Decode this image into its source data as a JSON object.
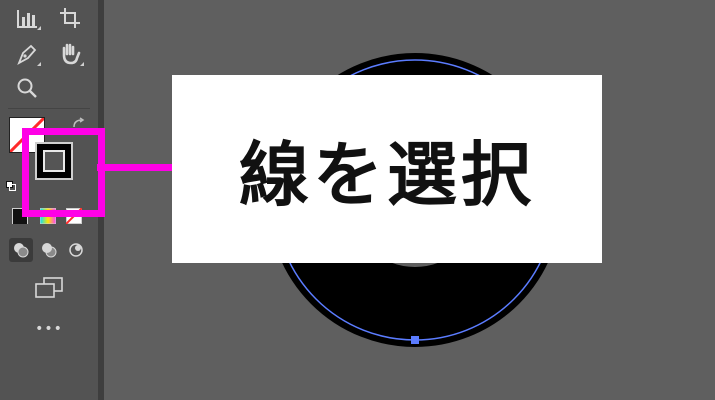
{
  "callout": {
    "text": "線を選択"
  },
  "colors": {
    "highlight": "#ff00e6",
    "canvas": "#5f5f5f",
    "toolbar": "#535353",
    "artwork_stroke": "#000000",
    "path": "#5b7cff"
  },
  "toolbar": {
    "tools": [
      {
        "name": "column-graph-tool",
        "icon": "bar-chart-icon"
      },
      {
        "name": "artboard-tool",
        "icon": "artboard-icon"
      },
      {
        "name": "pen-tool",
        "icon": "pen-icon"
      },
      {
        "name": "hand-tool",
        "icon": "hand-icon"
      },
      {
        "name": "zoom-tool",
        "icon": "magnifier-icon"
      },
      {
        "name": "fill-swatch",
        "icon": "fill-none-icon"
      },
      {
        "name": "stroke-swatch",
        "icon": "stroke-icon"
      },
      {
        "name": "swap-fill-stroke",
        "icon": "swap-arrow-icon"
      },
      {
        "name": "color-mode",
        "icon": "color-icon"
      },
      {
        "name": "gradient-mode",
        "icon": "gradient-icon"
      },
      {
        "name": "none-mode",
        "icon": "none-icon"
      },
      {
        "name": "draw-normal",
        "icon": "draw-normal-icon"
      },
      {
        "name": "draw-behind",
        "icon": "draw-behind-icon"
      },
      {
        "name": "draw-inside",
        "icon": "draw-inside-icon"
      },
      {
        "name": "change-screen-mode",
        "icon": "screen-mode-icon"
      },
      {
        "name": "edit-toolbar",
        "icon": "more-icon"
      }
    ],
    "more_label": "•••"
  }
}
